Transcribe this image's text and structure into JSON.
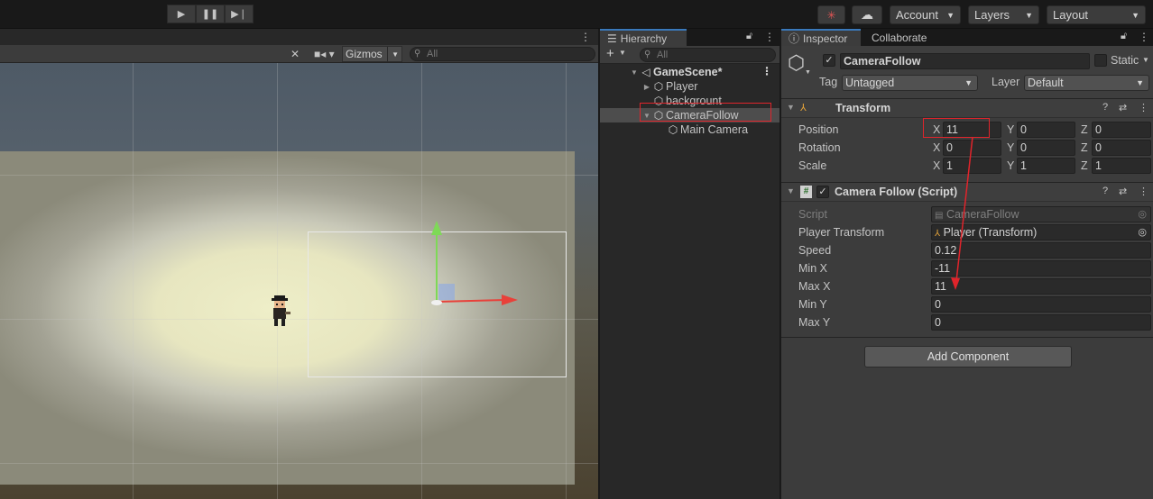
{
  "toolbar": {
    "play_icon": "play-icon",
    "pause_icon": "pause-icon",
    "step_icon": "step-icon",
    "account_label": "Account",
    "layers_label": "Layers",
    "layout_label": "Layout"
  },
  "scene": {
    "gizmos_label": "Gizmos",
    "search_placeholder": "All"
  },
  "hierarchy": {
    "tab_label": "Hierarchy",
    "search_placeholder": "All",
    "items": [
      {
        "label": "GameScene*",
        "depth": 0,
        "expanded": true,
        "icon": "unity-scene-icon"
      },
      {
        "label": "Player",
        "depth": 1,
        "expanded": false,
        "icon": "gameobject-cube-icon"
      },
      {
        "label": "backgrount",
        "depth": 1,
        "expanded": null,
        "icon": "gameobject-cube-icon"
      },
      {
        "label": "CameraFollow",
        "depth": 1,
        "expanded": true,
        "icon": "gameobject-cube-icon",
        "selected": true
      },
      {
        "label": "Main Camera",
        "depth": 2,
        "expanded": null,
        "icon": "gameobject-cube-icon"
      }
    ]
  },
  "inspector": {
    "tabs": [
      "Inspector",
      "Collaborate"
    ],
    "object_name": "CameraFollow",
    "static_label": "Static",
    "tag_label": "Tag",
    "tag_value": "Untagged",
    "layer_label": "Layer",
    "layer_value": "Default",
    "transform": {
      "title": "Transform",
      "rows": [
        {
          "label": "Position",
          "x": "11",
          "y": "0",
          "z": "0"
        },
        {
          "label": "Rotation",
          "x": "0",
          "y": "0",
          "z": "0"
        },
        {
          "label": "Scale",
          "x": "1",
          "y": "1",
          "z": "1"
        }
      ],
      "axis_x": "X",
      "axis_y": "Y",
      "axis_z": "Z"
    },
    "camera_follow": {
      "title": "Camera Follow (Script)",
      "script_label": "Script",
      "script_value": "CameraFollow",
      "player_transform_label": "Player Transform",
      "player_transform_value": "Player (Transform)",
      "speed_label": "Speed",
      "speed_value": "0.12",
      "min_x_label": "Min X",
      "min_x_value": "-11",
      "max_x_label": "Max X",
      "max_x_value": "11",
      "min_y_label": "Min Y",
      "min_y_value": "0",
      "max_y_label": "Max Y",
      "max_y_value": "0"
    },
    "add_component_label": "Add Component"
  },
  "colors": {
    "annotation_red": "#e0242b",
    "selection_blue": "#3a79bb",
    "gizmo_green": "#7ed957",
    "gizmo_red": "#e8413a"
  }
}
